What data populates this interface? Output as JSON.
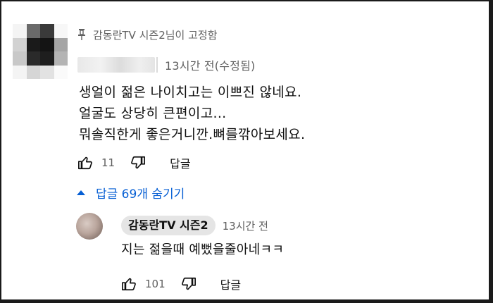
{
  "comment": {
    "pinned_label": "감동란TV 시즌2님이 고정함",
    "timestamp": "13시간 전(수정됨)",
    "lines": [
      "생얼이 젊은 나이치고는 이쁘진 않네요.",
      "얼굴도 상당히 큰편이고...",
      "뭐솔직한게 좋은거니깐.뼈를깎아보세요."
    ],
    "like_count": "11",
    "reply_label": "답글"
  },
  "replies_toggle": {
    "label": "답글 69개 숨기기",
    "color": "#065fd4"
  },
  "reply": {
    "author": "감동란TV 시즌2",
    "timestamp": "13시간 전",
    "text": "지는 젊을때 예뻤을줄아네ㅋㅋ",
    "like_count": "101",
    "reply_label": "답글"
  },
  "icons": {
    "pin": "pin-icon",
    "like": "thumbs-up-icon",
    "dislike": "thumbs-down-icon",
    "toggle": "caret-up-icon"
  },
  "colors": {
    "text_primary": "#0f0f0f",
    "text_secondary": "#606060",
    "link_blue": "#065fd4",
    "chip_bg": "#e5e5e5"
  }
}
